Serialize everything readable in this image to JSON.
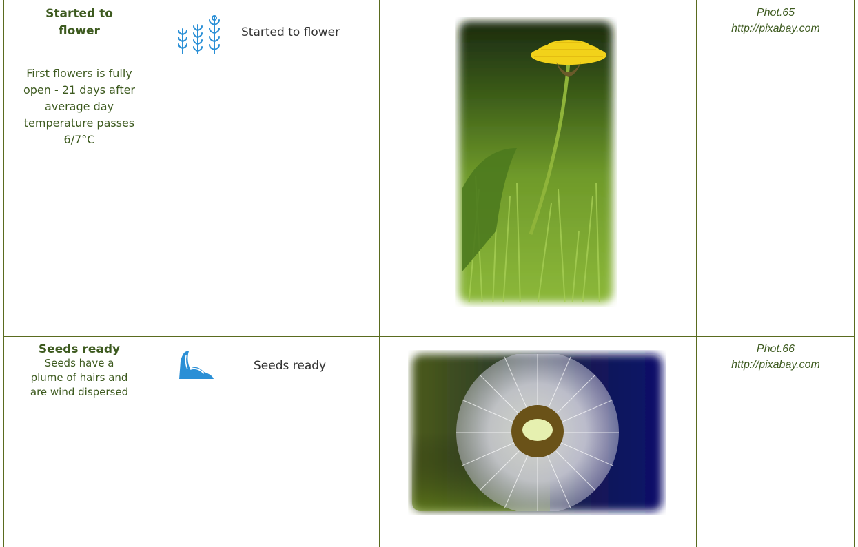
{
  "rows": [
    {
      "title": "Started to flower",
      "description": "First flowers is fully open - 21 days after average day temperature passes 6/7°C",
      "stage_label": "Started to flower",
      "stage_icon": "flowering-plants-icon",
      "photo_subject": "dandelion-flower",
      "credit_number": "Phot.65",
      "credit_url": "http://pixabay.com"
    },
    {
      "title": "Seeds ready",
      "description": "Seeds have a plume of hairs and are wind dispersed",
      "stage_label": "Seeds ready",
      "stage_icon": "seed-plume-icon",
      "photo_subject": "dandelion-seed-head",
      "credit_number": "Phot.66",
      "credit_url": "http://pixabay.com"
    }
  ],
  "colors": {
    "text_green": "#3d5a1f",
    "rule_color": "#5a6b1f",
    "icon_blue": "#2a8fd6"
  }
}
